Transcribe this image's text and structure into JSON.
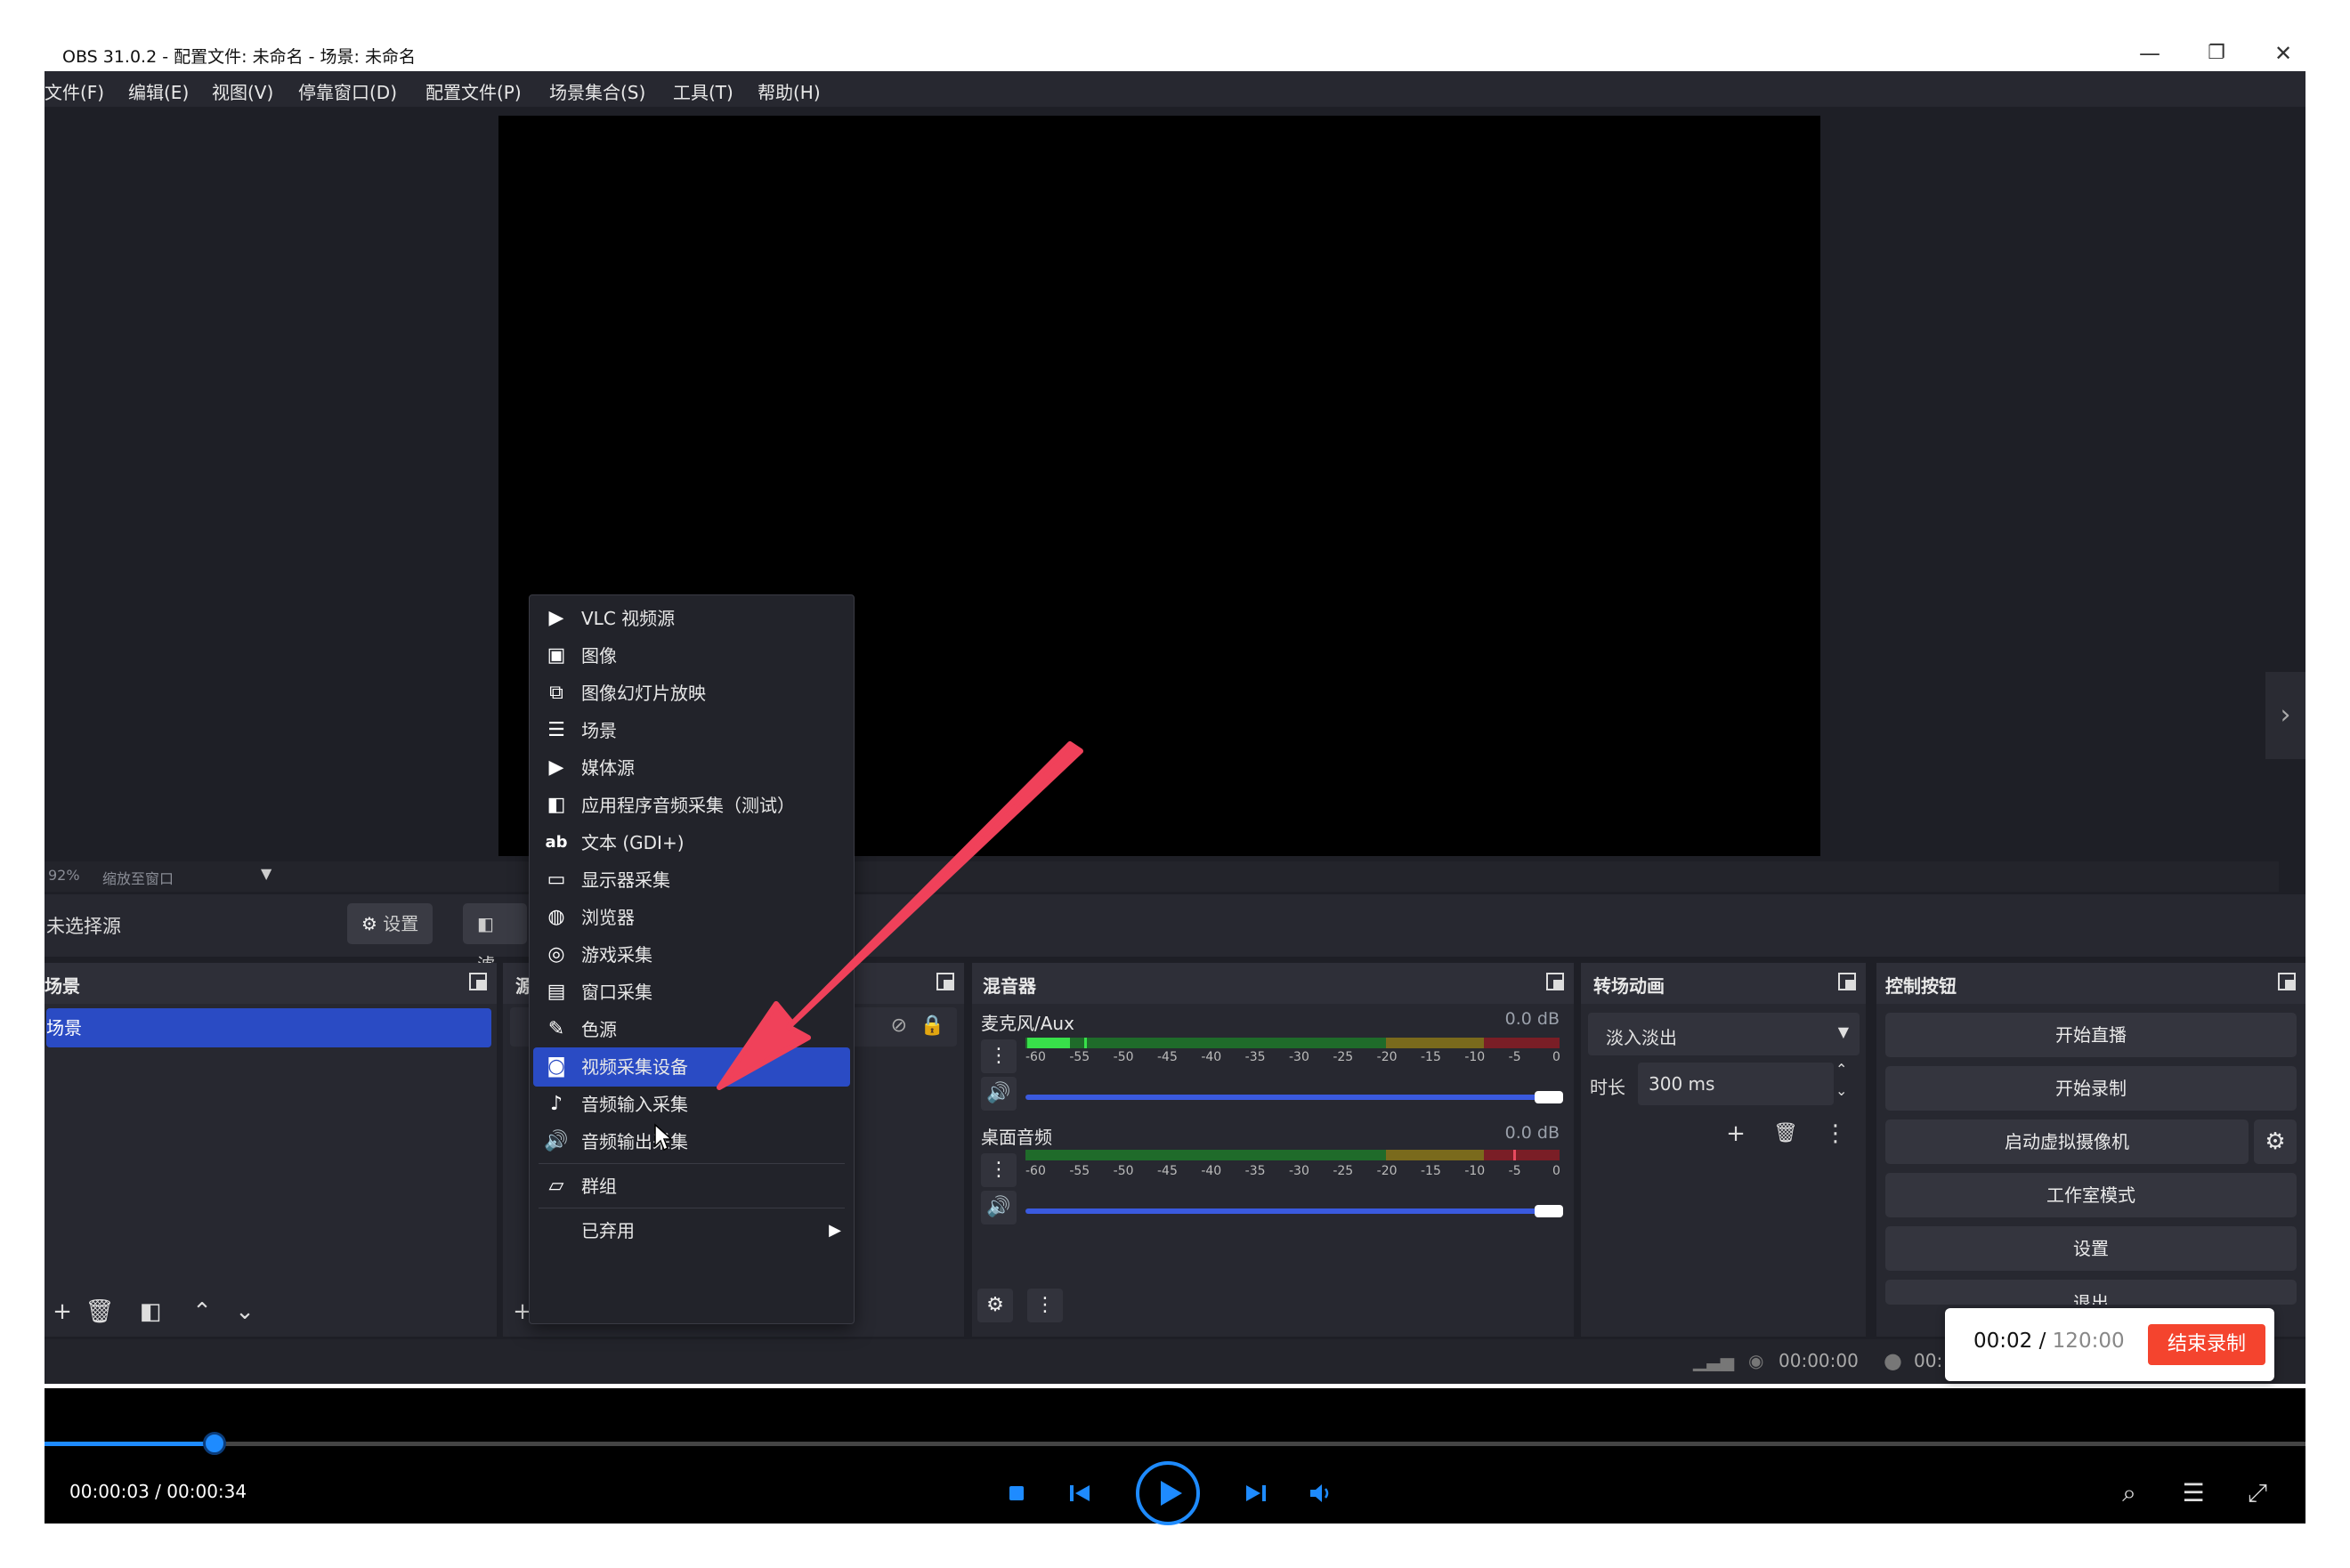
{
  "window": {
    "title": "OBS 31.0.2 - 配置文件: 未命名 - 场景: 未命名",
    "minimize": "—",
    "maximize": "❐",
    "close": "✕"
  },
  "menubar": [
    "文件(F)",
    "编辑(E)",
    "视图(V)",
    "停靠窗口(D)",
    "配置文件(P)",
    "场景集合(S)",
    "工具(T)",
    "帮助(H)"
  ],
  "zoom": {
    "percent": "92%",
    "label": "缩放至窗口"
  },
  "context_bar": {
    "no_source": "未选择源",
    "settings": "设置",
    "filters": "滤"
  },
  "scenes": {
    "header": "场景",
    "items": [
      "场景"
    ]
  },
  "sources": {
    "header": "源"
  },
  "mixer": {
    "header": "混音器",
    "tracks": [
      {
        "name": "麦克风/Aux",
        "db": "0.0 dB"
      },
      {
        "name": "桌面音频",
        "db": "0.0 dB"
      }
    ],
    "scale": [
      "-60",
      "-55",
      "-50",
      "-45",
      "-40",
      "-35",
      "-30",
      "-25",
      "-20",
      "-15",
      "-10",
      "-5",
      "0"
    ]
  },
  "transitions": {
    "header": "转场动画",
    "selected": "淡入淡出",
    "duration_label": "时长",
    "duration_value": "300 ms"
  },
  "controls": {
    "header": "控制按钮",
    "buttons": [
      "开始直播",
      "开始录制",
      "启动虚拟摄像机",
      "工作室模式",
      "设置",
      "退出"
    ]
  },
  "statusbar": {
    "stream_time": "00:00:00",
    "rec_time": "00:"
  },
  "context_menu": {
    "items": [
      {
        "label": "VLC 视频源",
        "icon": "play-icon"
      },
      {
        "label": "图像",
        "icon": "image-icon"
      },
      {
        "label": "图像幻灯片放映",
        "icon": "slideshow-icon"
      },
      {
        "label": "场景",
        "icon": "list-icon"
      },
      {
        "label": "媒体源",
        "icon": "play-icon"
      },
      {
        "label": "应用程序音频采集（测试）",
        "icon": "app-audio-icon"
      },
      {
        "label": "文本 (GDI+)",
        "icon": "text-icon"
      },
      {
        "label": "显示器采集",
        "icon": "monitor-icon"
      },
      {
        "label": "浏览器",
        "icon": "globe-icon"
      },
      {
        "label": "游戏采集",
        "icon": "gamepad-icon"
      },
      {
        "label": "窗口采集",
        "icon": "window-icon"
      },
      {
        "label": "色源",
        "icon": "brush-icon"
      },
      {
        "label": "视频采集设备",
        "icon": "camera-icon"
      },
      {
        "label": "音频输入采集",
        "icon": "microphone-icon"
      },
      {
        "label": "音频输出采集",
        "icon": "speaker-icon"
      },
      {
        "label": "群组",
        "icon": "folder-icon"
      },
      {
        "label": "已弃用",
        "icon": ""
      }
    ],
    "selected_index": 12
  },
  "recording_popup": {
    "elapsed": "00:02",
    "separator": " / ",
    "total": "120:00",
    "stop": "结束录制"
  },
  "player": {
    "time": "00:00:03 / 00:00:34",
    "progress": 0.09
  },
  "colors": {
    "accent": "#2a4bc4",
    "arrow": "#f0415a",
    "player_accent": "#1e8bff",
    "stop": "#f4442e"
  }
}
